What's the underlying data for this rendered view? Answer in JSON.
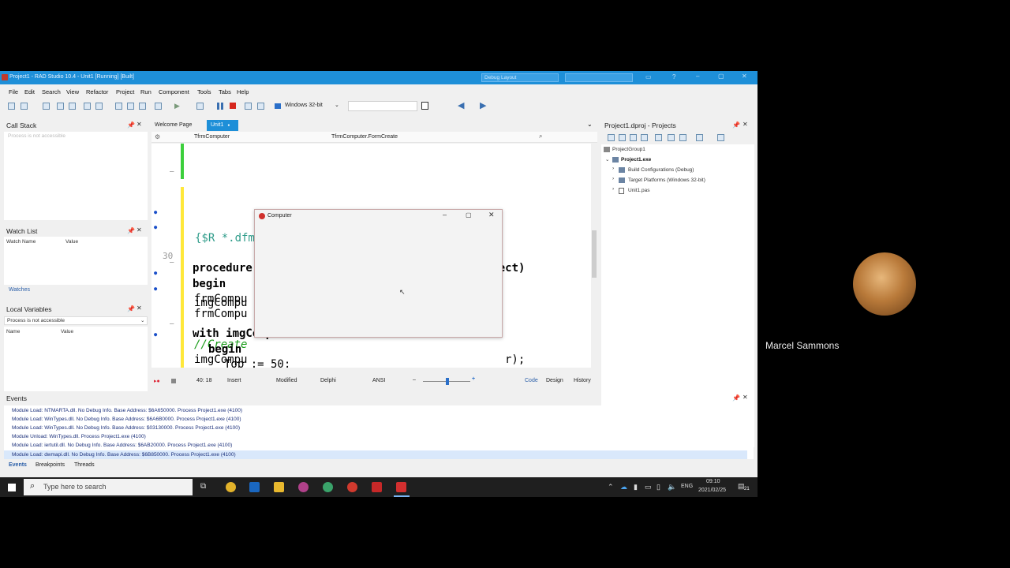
{
  "ide": {
    "title": "Project1 - RAD Studio 10.4 - Unit1 [Running] [Built]",
    "layout_dropdown": "Debug Layout",
    "menu": [
      "File",
      "Edit",
      "Search",
      "View",
      "Refactor",
      "Project",
      "Run",
      "Component",
      "Tools",
      "Tabs",
      "Help"
    ],
    "platform": "Windows 32-bit"
  },
  "call_stack": {
    "title": "Call Stack",
    "empty_text": "Process is not accessible"
  },
  "watch_list": {
    "title": "Watch List",
    "col_name": "Watch Name",
    "col_value": "Value",
    "tab": "Watches"
  },
  "local_vars": {
    "title": "Local Variables",
    "dropdown": "Process is not accessible",
    "col_name": "Name",
    "col_value": "Value"
  },
  "editor": {
    "tabs": [
      "Welcome Page",
      "Unit1"
    ],
    "class_combo": "TfrmComputer",
    "method_combo": "TfrmComputer.FormCreate",
    "gutter_number": "30",
    "lines": [
      "{$R *.dfm}",
      "procedure TfrmComputer.FormCreate(Sender: TObject)",
      "begin",
      "frmCompu",
      "frmCompu",
      "//Create",
      "imgCompu",
      "r);",
      "imgCompu",
      "with imgComputer do",
      "begin",
      "Top := 50;"
    ]
  },
  "status": {
    "position": "40: 18",
    "mode": "Insert",
    "modified": "Modified",
    "language": "Delphi",
    "encoding": "ANSI",
    "zoom_minus": "–",
    "zoom_plus": "+",
    "tabs": [
      "Code",
      "Design",
      "History"
    ]
  },
  "projects": {
    "title": "Project1.dproj - Projects",
    "tree": [
      "ProjectGroup1",
      "Project1.exe",
      "Build Configurations (Debug)",
      "Target Platforms (Windows 32-bit)",
      "Unit1.pas"
    ]
  },
  "events": {
    "title": "Events",
    "lines": [
      "Module Load: NTMARTA.dll. No Debug Info. Base Address: $6A650000. Process Project1.exe (4100)",
      "Module Load: WinTypes.dll. No Debug Info. Base Address: $6A6B0000. Process Project1.exe (4100)",
      "Module Load: WinTypes.dll. No Debug Info. Base Address: $03130000. Process Project1.exe (4100)",
      "Module Unload: WinTypes.dll. Process Project1.exe (4100)",
      "Module Load: iertutil.dll. No Debug Info. Base Address: $6AB20000. Process Project1.exe (4100)",
      "Module Load: dwmapi.dll. No Debug Info. Base Address: $6B850000. Process Project1.exe (4100)"
    ],
    "tabs": [
      "Events",
      "Breakpoints",
      "Threads"
    ]
  },
  "dialog": {
    "title": "Computer"
  },
  "taskbar": {
    "search_placeholder": "Type here to search",
    "lang": "ENG",
    "time": "09:10",
    "date": "2021/02/25",
    "notif_count": "21"
  },
  "participant": {
    "name": "Marcel Sammons"
  },
  "colors": {
    "accent": "#1e8fd8",
    "taskbar": "#1f1f1f",
    "code_green": "#2f9c8a",
    "comment": "#1a9c1a"
  }
}
